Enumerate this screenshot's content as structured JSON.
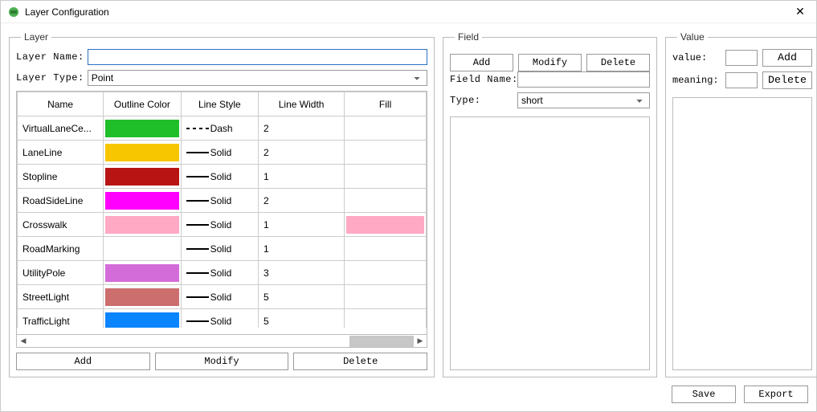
{
  "window": {
    "title": "Layer Configuration",
    "close_icon": "✕"
  },
  "layer": {
    "legend": "Layer",
    "name_label": "Layer Name:",
    "name_value": "",
    "type_label": "Layer Type:",
    "type_value": "Point",
    "columns": {
      "name": "Name",
      "outline_color": "Outline Color",
      "line_style": "Line Style",
      "line_width": "Line Width",
      "fill": "Fill"
    },
    "rows": [
      {
        "name": "VirtualLaneCe...",
        "color": "#1fbf2a",
        "style": "Dash",
        "style_kind": "dash",
        "width": "2",
        "fill": ""
      },
      {
        "name": "LaneLine",
        "color": "#f7c600",
        "style": "Solid",
        "style_kind": "solid",
        "width": "2",
        "fill": ""
      },
      {
        "name": "Stopline",
        "color": "#b81414",
        "style": "Solid",
        "style_kind": "solid",
        "width": "1",
        "fill": ""
      },
      {
        "name": "RoadSideLine",
        "color": "#ff00ff",
        "style": "Solid",
        "style_kind": "solid",
        "width": "2",
        "fill": ""
      },
      {
        "name": "Crosswalk",
        "color": "#ffa9c5",
        "style": "Solid",
        "style_kind": "solid",
        "width": "1",
        "fill": "#ffa9c5"
      },
      {
        "name": "RoadMarking",
        "color": "",
        "style": "Solid",
        "style_kind": "solid",
        "width": "1",
        "fill": ""
      },
      {
        "name": "UtilityPole",
        "color": "#d36cd8",
        "style": "Solid",
        "style_kind": "solid",
        "width": "3",
        "fill": ""
      },
      {
        "name": "StreetLight",
        "color": "#cc6e6e",
        "style": "Solid",
        "style_kind": "solid",
        "width": "5",
        "fill": ""
      },
      {
        "name": "TrafficLight",
        "color": "#0a84ff",
        "style": "Solid",
        "style_kind": "solid",
        "width": "5",
        "fill": ""
      }
    ],
    "buttons": {
      "add": "Add",
      "modify": "Modify",
      "delete": "Delete"
    }
  },
  "field": {
    "legend": "Field",
    "buttons": {
      "add": "Add",
      "modify": "Modify",
      "delete": "Delete"
    },
    "name_label": "Field Name:",
    "name_value": "",
    "type_label": "Type:",
    "type_value": "short"
  },
  "value": {
    "legend": "Value",
    "value_label": "value:",
    "value_value": "",
    "add_label": "Add",
    "meaning_label": "meaning:",
    "meaning_value": "",
    "delete_label": "Delete"
  },
  "footer": {
    "save": "Save",
    "export": "Export"
  }
}
